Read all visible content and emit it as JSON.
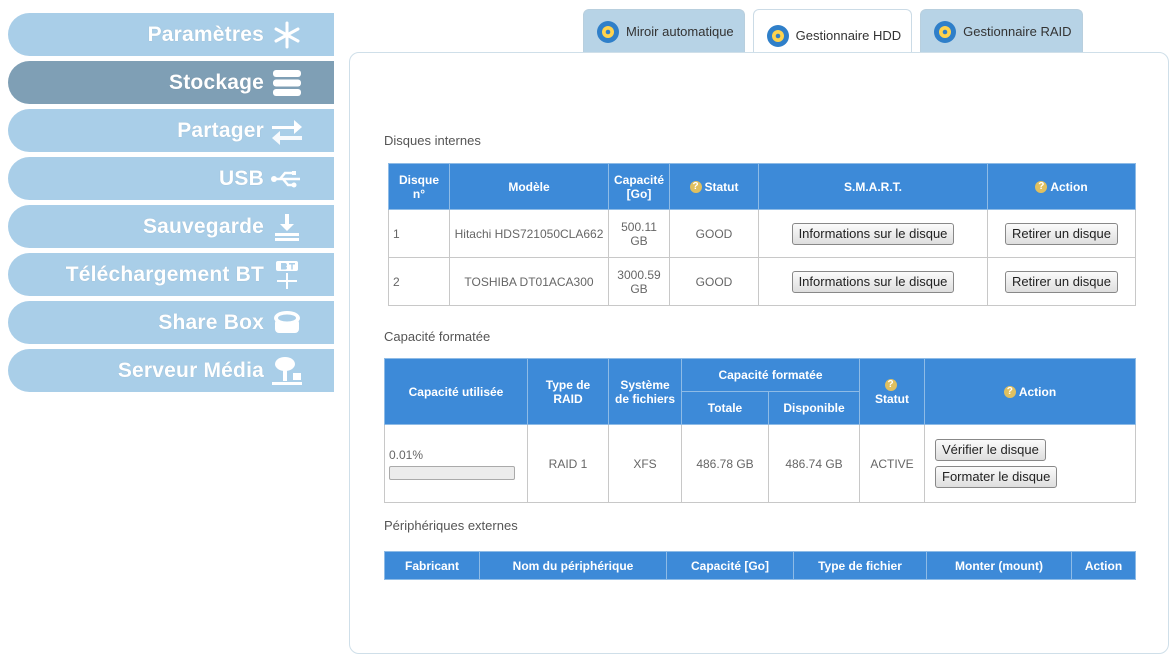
{
  "sidebar": {
    "items": [
      {
        "label": "Paramètres",
        "icon": "snowflake-icon",
        "active": false
      },
      {
        "label": "Stockage",
        "icon": "storage-icon",
        "active": true
      },
      {
        "label": "Partager",
        "icon": "share-arrows-icon",
        "active": false
      },
      {
        "label": "USB",
        "icon": "usb-icon",
        "active": false
      },
      {
        "label": "Sauvegarde",
        "icon": "download-tray-icon",
        "active": false
      },
      {
        "label": "Téléchargement BT",
        "icon": "bt-download-icon",
        "active": false
      },
      {
        "label": "Share Box",
        "icon": "share-box-icon",
        "active": false
      },
      {
        "label": "Serveur Média",
        "icon": "media-server-icon",
        "active": false
      }
    ]
  },
  "tabs": [
    {
      "label": "Miroir automatique",
      "active": false
    },
    {
      "label": "Gestionnaire HDD",
      "active": true
    },
    {
      "label": "Gestionnaire RAID",
      "active": false
    }
  ],
  "internal_disks": {
    "title": "Disques internes",
    "headers": {
      "disk_no": "Disque n°",
      "model": "Modèle",
      "capacity": "Capacité [Go]",
      "status": "Statut",
      "smart": "S.M.A.R.T.",
      "action": "Action"
    },
    "rows": [
      {
        "no": "1",
        "model": "Hitachi HDS721050CLA662",
        "capacity": "500.11 GB",
        "status": "GOOD",
        "smart_btn": "Informations sur le disque",
        "action_btn": "Retirer un disque"
      },
      {
        "no": "2",
        "model": "TOSHIBA DT01ACA300",
        "capacity": "3000.59 GB",
        "status": "GOOD",
        "smart_btn": "Informations sur le disque",
        "action_btn": "Retirer un disque"
      }
    ]
  },
  "formatted": {
    "title": "Capacité formatée",
    "headers": {
      "used": "Capacité utilisée",
      "raid_type": "Type de RAID",
      "fs": "Système de fichiers",
      "formatted": "Capacité formatée",
      "total": "Totale",
      "available": "Disponible",
      "status": "Statut",
      "action": "Action"
    },
    "row": {
      "used": "0.01%",
      "used_fraction": 0.0001,
      "raid_type": "RAID 1",
      "fs": "XFS",
      "total": "486.78 GB",
      "available": "486.74 GB",
      "status": "ACTIVE",
      "verify_btn": "Vérifier le disque",
      "format_btn": "Formater le disque"
    }
  },
  "external": {
    "title": "Périphériques externes",
    "headers": {
      "maker": "Fabricant",
      "device": "Nom du périphérique",
      "capacity": "Capacité [Go]",
      "filetype": "Type de fichier",
      "mount": "Monter (mount)",
      "action": "Action"
    }
  },
  "colors": {
    "sidebar": "#a9cee8",
    "sidebar_active": "#7f9fb5",
    "header": "#3d8ad8",
    "tab": "#b7d3e6"
  }
}
